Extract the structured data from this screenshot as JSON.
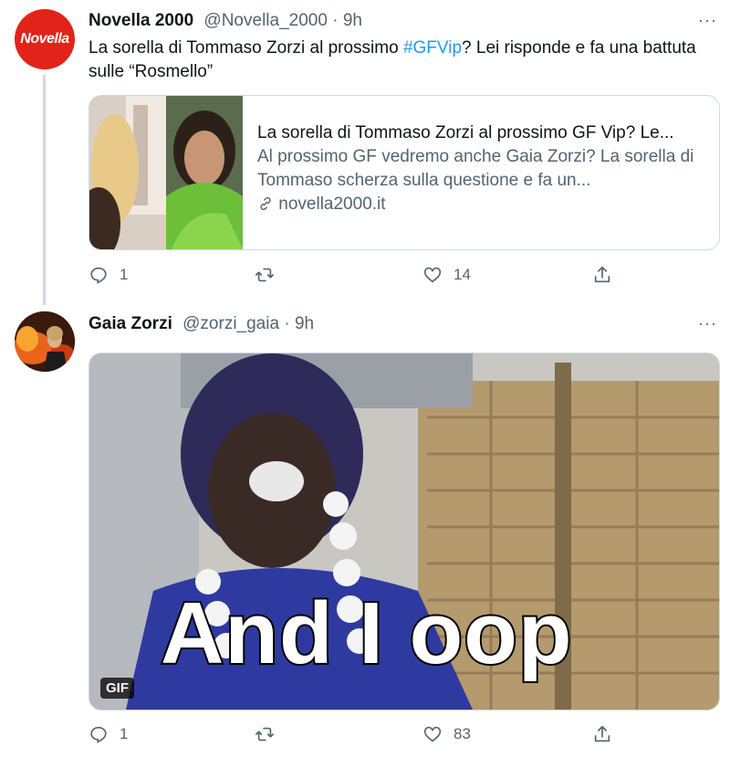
{
  "tweet1": {
    "name": "Novella 2000",
    "handle": "@Novella_2000",
    "separator": "·",
    "time": "9h",
    "more": "···",
    "text_before": "La sorella di Tommaso Zorzi al prossimo ",
    "hashtag": "#GFVip",
    "text_after": "? Lei risponde e fa una battuta sulle “Rosmello”",
    "avatar_logo": "Novella",
    "card": {
      "title": "La sorella di Tommaso Zorzi al prossimo GF Vip? Le...",
      "description": "Al prossimo GF vedremo anche Gaia Zorzi? La sorella di Tommaso scherza sulla questione e fa un...",
      "domain": "novella2000.it"
    },
    "actions": {
      "replies": "1",
      "retweets": "",
      "likes": "14"
    }
  },
  "tweet2": {
    "name": "Gaia Zorzi",
    "handle": "@zorzi_gaia",
    "separator": "·",
    "time": "9h",
    "more": "···",
    "gif_badge": "GIF",
    "gif_caption": "And I oop",
    "actions": {
      "replies": "1",
      "retweets": "",
      "likes": "83"
    }
  },
  "colors": {
    "accent": "#1d9bf0",
    "muted": "#536471",
    "novella_red": "#e2231a"
  }
}
